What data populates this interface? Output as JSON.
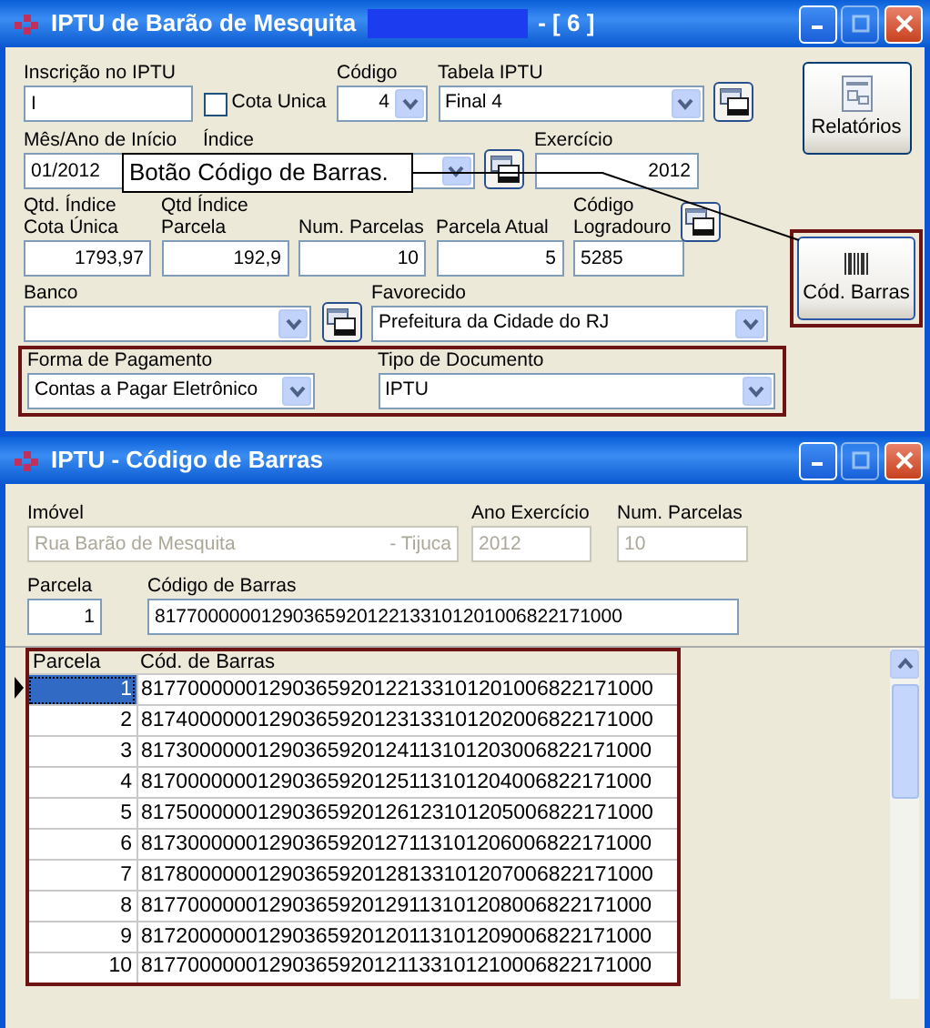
{
  "main_window": {
    "title": "IPTU de Barão de Mesquita",
    "title_suffix": "- [ 6 ]",
    "rows": [
      [
        {
          "kind": "text",
          "label": "Inscrição no IPTU",
          "value": "I"
        },
        {
          "kind": "checkbox",
          "label": "Cota Unica",
          "checked": false
        },
        {
          "kind": "numselect",
          "label": "Código",
          "value": "4"
        },
        {
          "kind": "select",
          "label": "Tabela IPTU",
          "value": "Final 4"
        },
        {
          "kind": "lookup"
        }
      ],
      [
        {
          "kind": "text",
          "label": "Mês/Ano de Início",
          "value": "01/2012"
        },
        {
          "kind": "select",
          "label": "Índice"
        },
        {
          "kind": "lookup"
        },
        {
          "kind": "number",
          "label": "Exercício",
          "value": "2012"
        }
      ],
      [
        {
          "kind": "number",
          "label": "Qtd. Índice\nCota Única",
          "value": "1793,97"
        },
        {
          "kind": "number",
          "label": "Qtd Índice\nParcela",
          "value": "192,9"
        },
        {
          "kind": "number",
          "label": "Num. Parcelas",
          "value": "10"
        },
        {
          "kind": "number",
          "label": "Parcela Atual",
          "value": "5"
        },
        {
          "kind": "text",
          "label": "Código\nLogradouro",
          "value": "5285"
        },
        {
          "kind": "lookup"
        }
      ],
      [
        {
          "kind": "select",
          "label": "Banco"
        },
        {
          "kind": "lookup"
        },
        {
          "kind": "select",
          "label": "Favorecido",
          "value": "Prefeitura da Cidade do RJ"
        }
      ]
    ],
    "payment_group": {
      "highlighted": true,
      "fields": [
        {
          "kind": "select",
          "label": "Forma de Pagamento",
          "value": "Contas a Pagar Eletrônico"
        },
        {
          "kind": "select",
          "label": "Tipo de Documento",
          "value": "IPTU"
        }
      ]
    },
    "reports_button": {
      "label": "Relatórios"
    },
    "barcode_button": {
      "label": "Cód. Barras",
      "highlighted": true
    },
    "tooltip": {
      "text": "Botão Código de Barras."
    }
  },
  "barcode_window": {
    "title": "IPTU - Código de Barras",
    "rows": [
      [
        {
          "kind": "text",
          "label": "Imóvel",
          "value": "Rua Barão de Mesquita",
          "value_suffix": "- Tijuca",
          "disabled": true
        },
        {
          "kind": "text",
          "label": "Ano Exercício",
          "value": "2012",
          "disabled": true
        },
        {
          "kind": "text",
          "label": "Num. Parcelas",
          "value": "10",
          "disabled": true
        }
      ],
      [
        {
          "kind": "number",
          "label": "Parcela",
          "value": "1",
          "disabled": false
        },
        {
          "kind": "text",
          "label": "Código de Barras",
          "value": "81770000001290365920122133101201006822171000",
          "disabled": false
        }
      ]
    ],
    "grid": {
      "highlighted": true,
      "columns": [
        "Parcela",
        "Cód. de Barras"
      ],
      "rows": [
        {
          "parcela": "1",
          "code": "81770000001290365920122133101201006822171000",
          "selected": true
        },
        {
          "parcela": "2",
          "code": "81740000001290365920123133101202006822171000",
          "selected": false
        },
        {
          "parcela": "3",
          "code": "81730000001290365920124113101203006822171000",
          "selected": false
        },
        {
          "parcela": "4",
          "code": "81700000001290365920125113101204006822171000",
          "selected": false
        },
        {
          "parcela": "5",
          "code": "81750000001290365920126123101205006822171000",
          "selected": false
        },
        {
          "parcela": "6",
          "code": "81730000001290365920127113101206006822171000",
          "selected": false
        },
        {
          "parcela": "7",
          "code": "81780000001290365920128133101207006822171000",
          "selected": false
        },
        {
          "parcela": "8",
          "code": "81770000001290365920129113101208006822171000",
          "selected": false
        },
        {
          "parcela": "9",
          "code": "81720000001290365920120113101209006822171000",
          "selected": false
        },
        {
          "parcela": "10",
          "code": "81770000001290365920121133101210006822171000",
          "selected": false
        }
      ]
    }
  }
}
